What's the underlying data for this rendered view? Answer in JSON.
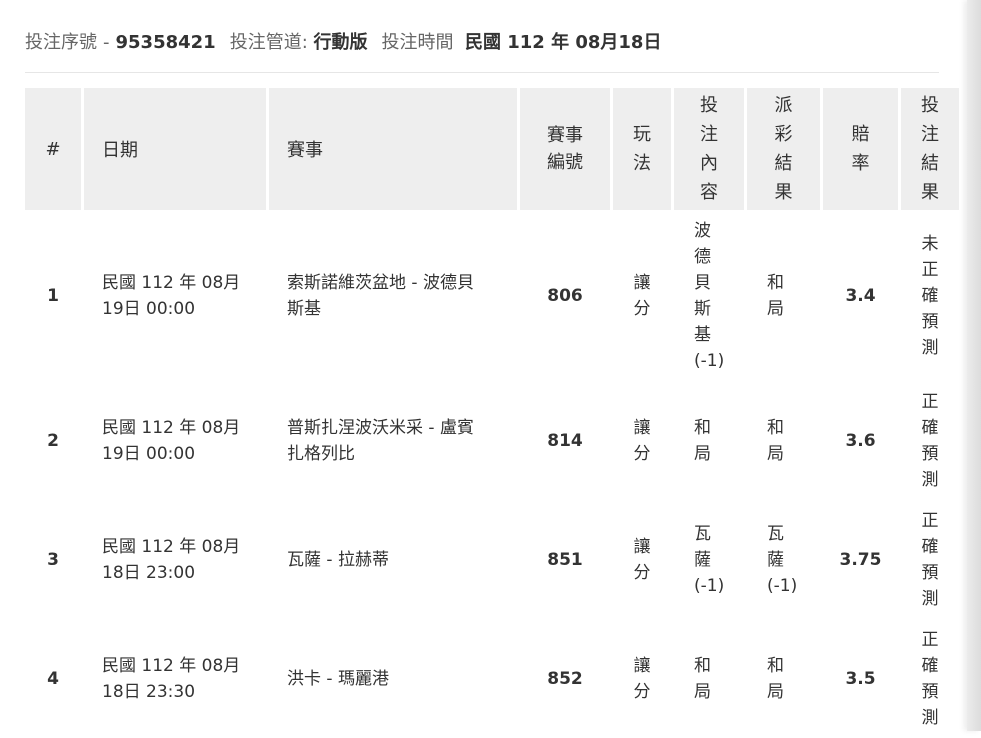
{
  "meta": {
    "serial_label": "投注序號",
    "serial_sep": "-",
    "serial_value": "95358421",
    "channel_label": "投注管道:",
    "channel_value": "行動版",
    "time_label": "投注時間",
    "time_value": "民國 112 年 08月18日"
  },
  "table": {
    "headers": [
      "#",
      "日期",
      "賽事",
      "賽事編號",
      "玩法",
      "投注內容",
      "派彩結果",
      "賠率",
      "投注結果"
    ],
    "rows": [
      {
        "index": "1",
        "date_line1": "民國 112 年 08月",
        "date_line2": "19日 00:00",
        "match_line1": "索斯諾維茨盆地 - 波德貝",
        "match_line2": "斯基",
        "match_no": "806",
        "play": "讓分",
        "bet": "波德貝斯基(-1)",
        "payout": "和局",
        "odds": "3.4",
        "result": "未正確預測"
      },
      {
        "index": "2",
        "date_line1": "民國 112 年 08月",
        "date_line2": "19日 00:00",
        "match_line1": "普斯扎涅波沃米采 - 盧賓",
        "match_line2": "扎格列比",
        "match_no": "814",
        "play": "讓分",
        "bet": "和局",
        "payout": "和局",
        "odds": "3.6",
        "result": "正確預測"
      },
      {
        "index": "3",
        "date_line1": "民國 112 年 08月",
        "date_line2": "18日 23:00",
        "match_line1": "瓦薩 - 拉赫蒂",
        "match_line2": "",
        "match_no": "851",
        "play": "讓分",
        "bet": "瓦薩(-1)",
        "payout": "瓦薩(-1)",
        "odds": "3.75",
        "result": "正確預測"
      },
      {
        "index": "4",
        "date_line1": "民國 112 年 08月",
        "date_line2": "18日 23:30",
        "match_line1": "洪卡 - 瑪麗港",
        "match_line2": "",
        "match_no": "852",
        "play": "讓分",
        "bet": "和局",
        "payout": "和局",
        "odds": "3.5",
        "result": "正確預測"
      }
    ]
  }
}
